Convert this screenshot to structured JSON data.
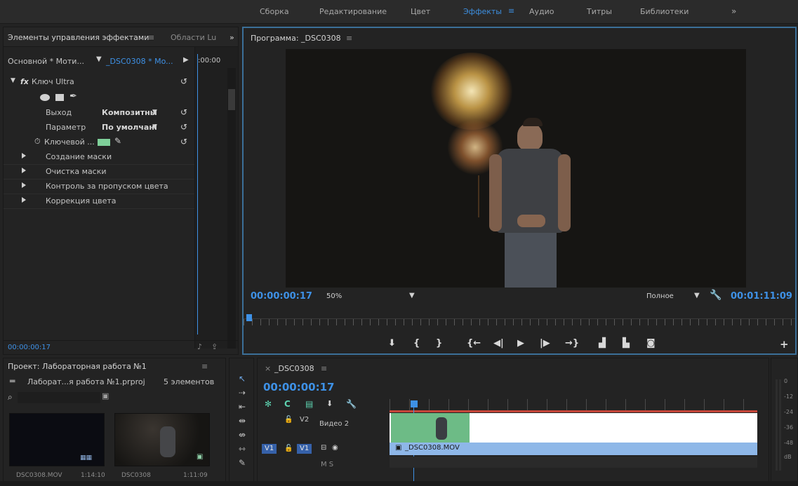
{
  "workspaces": {
    "items": [
      "Сборка",
      "Редактирование",
      "Цвет",
      "Эффекты",
      "Аудио",
      "Титры",
      "Библиотеки"
    ],
    "active": "Эффекты",
    "more": "»",
    "menu_glyph": "≡"
  },
  "effects_panel": {
    "tab_title": "Элементы управления эффектами",
    "tab_menu": "≡",
    "tab2": "Области Lu",
    "more": "»",
    "master_clip": "Основной * Моти...",
    "sequence_clip": "_DSC0308 * Mo...",
    "time_ruler": ":00:00",
    "effect_name": "Ключ Ultra",
    "fx_badge": "fx",
    "params": [
      {
        "label": "Выход",
        "value": "Композитны"
      },
      {
        "label": "Параметр",
        "value": "По умолчані"
      }
    ],
    "key_color_label": "Ключевой ...",
    "key_color": "#7fd09a",
    "sections": [
      "Создание маски",
      "Очистка маски",
      "Контроль за пропуском цвета",
      "Коррекция цвета"
    ],
    "timecode": "00:00:00:17"
  },
  "program_monitor": {
    "title": "Программа: _DSC0308",
    "menu_glyph": "≡",
    "timecode": "00:00:00:17",
    "zoom": "50%",
    "quality": "Полное",
    "duration": "00:01:11:09"
  },
  "project_panel": {
    "title": "Проект: Лабораторная работа №1",
    "menu_glyph": "≡",
    "file_name": "Лаборат...я работа №1.prproj",
    "item_count": "5 элементов",
    "items": [
      {
        "name": "DSC0308.MOV",
        "duration": "1:14:10"
      },
      {
        "name": "DSC0308",
        "duration": "1:11:09"
      }
    ]
  },
  "timeline": {
    "tab_title": "_DSC0308",
    "menu_glyph": "≡",
    "timecode": "00:00:00:17",
    "tracks": {
      "v2_label": "V2",
      "v2_name": "Видео 2",
      "v1_source": "V1",
      "v1_label": "V1",
      "clip_name": "_DSC0308.MOV",
      "audio_row": "M S"
    }
  },
  "audio_meter": {
    "scale": [
      "0",
      "-12",
      "-24",
      "-36",
      "-48",
      "dB"
    ]
  }
}
